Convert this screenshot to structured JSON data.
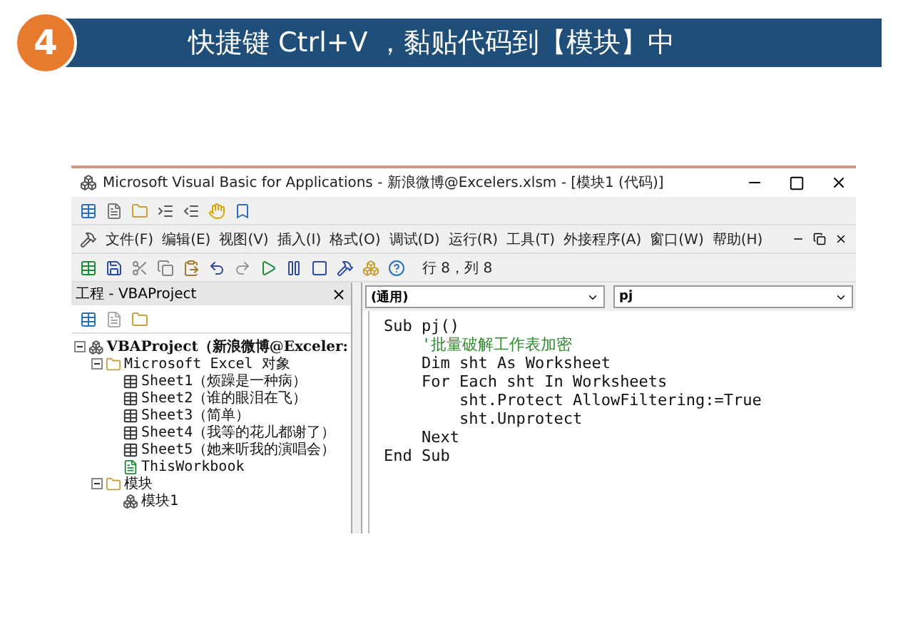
{
  "header": {
    "step": "4",
    "title": "快捷键 Ctrl+V ，黏贴代码到【模块】中"
  },
  "window": {
    "title": "Microsoft Visual Basic for Applications - 新浪微博@Excelers.xlsm - [模块1 (代码)]"
  },
  "menu": [
    "文件(F)",
    "编辑(E)",
    "视图(V)",
    "插入(I)",
    "格式(O)",
    "调试(D)",
    "运行(R)",
    "工具(T)",
    "外接程序(A)",
    "窗口(W)",
    "帮助(H)"
  ],
  "status": "行 8，列 8",
  "project_panel": {
    "title": "工程 - VBAProject",
    "tree": [
      {
        "kind": "project",
        "label": "VBAProject（新浪微博@Exceler:",
        "expanded": true,
        "children": [
          {
            "kind": "folder",
            "label": "Microsoft Excel 对象",
            "expanded": true,
            "children": [
              {
                "kind": "sheet",
                "label": "Sheet1（烦躁是一种病）"
              },
              {
                "kind": "sheet",
                "label": "Sheet2（谁的眼泪在飞）"
              },
              {
                "kind": "sheet",
                "label": "Sheet3（简单）"
              },
              {
                "kind": "sheet",
                "label": "Sheet4（我等的花儿都谢了）"
              },
              {
                "kind": "sheet",
                "label": "Sheet5（她来听我的演唱会）"
              },
              {
                "kind": "workbook",
                "label": "ThisWorkbook"
              }
            ]
          },
          {
            "kind": "folder",
            "label": "模块",
            "expanded": true,
            "children": [
              {
                "kind": "module",
                "label": "模块1"
              }
            ]
          }
        ]
      }
    ]
  },
  "code_window": {
    "object_dropdown": "(通用)",
    "procedure_dropdown": "pj",
    "lines": [
      {
        "kind": "code",
        "text": "Sub pj()"
      },
      {
        "kind": "comment",
        "text": "    '批量破解工作表加密"
      },
      {
        "kind": "code",
        "text": "    Dim sht As Worksheet"
      },
      {
        "kind": "code",
        "text": "    For Each sht In Worksheets"
      },
      {
        "kind": "code",
        "text": "        sht.Protect AllowFiltering:=True"
      },
      {
        "kind": "code",
        "text": "        sht.Unprotect"
      },
      {
        "kind": "code",
        "text": "    Next"
      },
      {
        "kind": "code",
        "text": "End Sub"
      }
    ]
  }
}
